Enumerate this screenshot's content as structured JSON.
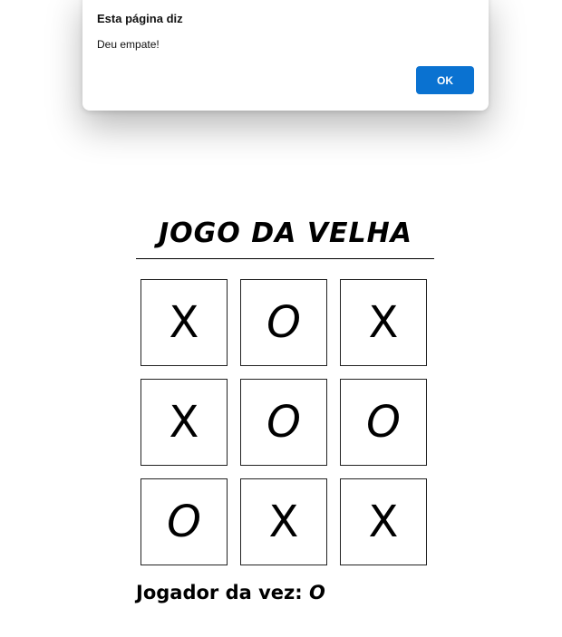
{
  "dialog": {
    "title": "Esta página diz",
    "message": "Deu empate!",
    "ok_label": "OK"
  },
  "game": {
    "title": "JOGO DA VELHA",
    "board": [
      "X",
      "O",
      "X",
      "X",
      "O",
      "O",
      "O",
      "X",
      "X"
    ],
    "status_label": "Jogador da vez:",
    "current_player": "O"
  },
  "colors": {
    "ok_button": "#0a72d1",
    "text": "#000000",
    "background": "#ffffff"
  }
}
